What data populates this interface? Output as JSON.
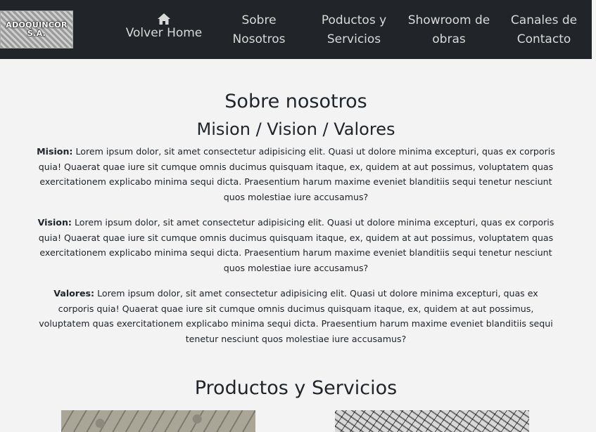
{
  "brand": {
    "logo_line1": "ADOQUINCOR",
    "logo_line2": "S.A."
  },
  "nav": {
    "home_icon": "home-icon",
    "items": [
      {
        "line1": "",
        "line2": "Volver Home"
      },
      {
        "line1": "Sobre",
        "line2": "Nosotros"
      },
      {
        "line1": "Poductos y",
        "line2": "Servicios"
      },
      {
        "line1": "Showroom de",
        "line2": "obras"
      },
      {
        "line1": "Canales de",
        "line2": "Contacto"
      }
    ]
  },
  "about": {
    "title": "Sobre nosotros",
    "subtitle": "Mision / Vision / Valores",
    "mision_label": "Mision:",
    "mision_text": " Lorem ipsum dolor, sit amet consectetur adipisicing elit. Quasi ut dolore minima excepturi, quas ex corporis quia! Quaerat quae iure sit cumque omnis ducimus quisquam itaque, ex, quidem at aut possimus, voluptatem quas exercitationem explicabo minima sequi dicta. Praesentium harum maxime eveniet blanditiis sequi tenetur nesciunt quos molestiae iure accusamus?",
    "vision_label": "Vision:",
    "vision_text": " Lorem ipsum dolor, sit amet consectetur adipisicing elit. Quasi ut dolore minima excepturi, quas ex corporis quia! Quaerat quae iure sit cumque omnis ducimus quisquam itaque, ex, quidem at aut possimus, voluptatem quas exercitationem explicabo minima sequi dicta. Praesentium harum maxime eveniet blanditiis sequi tenetur nesciunt quos molestiae iure accusamus?",
    "valores_label": "Valores:",
    "valores_text": " Lorem ipsum dolor, sit amet consectetur adipisicing elit. Quasi ut dolore minima excepturi, quas ex corporis quia! Quaerat quae iure sit cumque omnis ducimus quisquam itaque, ex, quidem at aut possimus, voluptatem quas exercitationem explicabo minima sequi dicta. Praesentium harum maxime eveniet blanditiis sequi tenetur nesciunt quos molestiae iure accusamus?"
  },
  "products": {
    "title": "Productos y Servicios"
  },
  "colors": {
    "navbar_bg": "#212529",
    "page_bg": "#f3f3f3",
    "text": "#212529",
    "nav_text": "#d9d9d9"
  }
}
